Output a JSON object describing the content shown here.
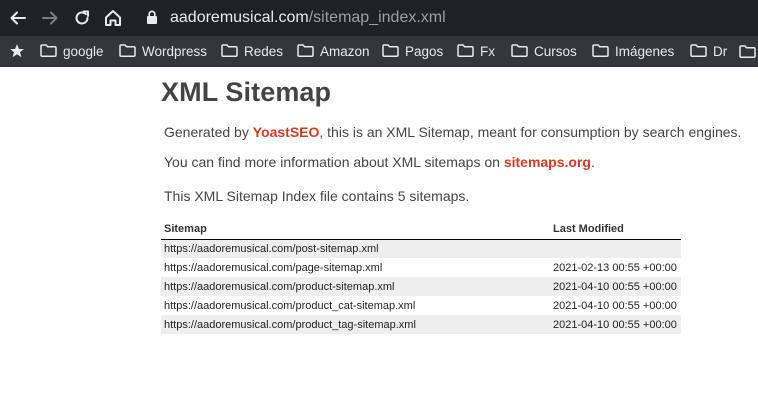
{
  "browser": {
    "url_host": "aadoremusical.com",
    "url_path": "/sitemap_index.xml",
    "bookmarks": [
      "google",
      "Wordpress",
      "Redes",
      "Amazon",
      "Pagos",
      "Fx",
      "Cursos",
      "Imágenes",
      "Dr"
    ]
  },
  "page": {
    "title": "XML Sitemap",
    "intro": {
      "prefix": "Generated by ",
      "link": "YoastSEO",
      "suffix": ", this is an XML Sitemap, meant for consumption by search engines."
    },
    "info": {
      "prefix": "You can find more information about XML sitemaps on ",
      "link": "sitemaps.org",
      "suffix": "."
    },
    "count_text": "This XML Sitemap Index file contains 5 sitemaps."
  },
  "table": {
    "headers": [
      "Sitemap",
      "Last Modified"
    ],
    "rows": [
      {
        "sitemap": "https://aadoremusical.com/post-sitemap.xml",
        "modified": ""
      },
      {
        "sitemap": "https://aadoremusical.com/page-sitemap.xml",
        "modified": "2021-02-13 00:55 +00:00"
      },
      {
        "sitemap": "https://aadoremusical.com/product-sitemap.xml",
        "modified": "2021-04-10 00:55 +00:00"
      },
      {
        "sitemap": "https://aadoremusical.com/product_cat-sitemap.xml",
        "modified": "2021-04-10 00:55 +00:00"
      },
      {
        "sitemap": "https://aadoremusical.com/product_tag-sitemap.xml",
        "modified": "2021-04-10 00:55 +00:00"
      }
    ]
  },
  "colors": {
    "chrome_bg": "#202124",
    "bookmarks_bg": "#35363a",
    "link_red": "#d03b24",
    "row_alt": "#eeeeee"
  }
}
